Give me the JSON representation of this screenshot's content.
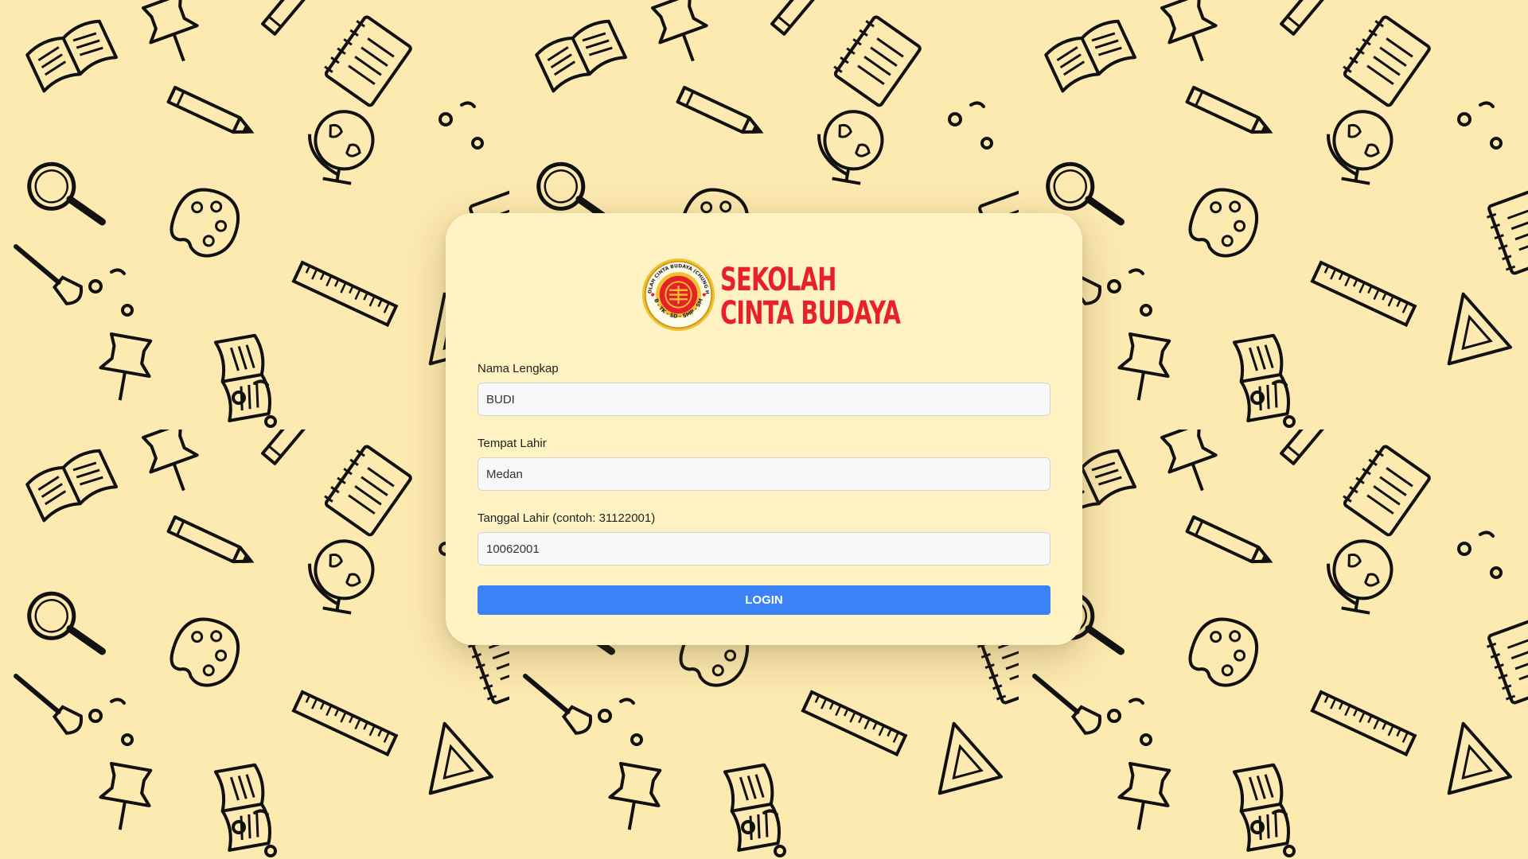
{
  "brand": {
    "line1": "SEKOLAH",
    "line2": "CINTA BUDAYA",
    "seal_ring_text": "SEKOLAH CINTA BUDAYA (CHUNG HUA)",
    "seal_grades_text": "KB - TK - SD - SMP - SMA",
    "brand_red": "#e8202a",
    "seal_gold": "#f2c230"
  },
  "form": {
    "name_label": "Nama Lengkap",
    "name_value": "BUDI",
    "birthplace_label": "Tempat Lahir",
    "birthplace_value": "Medan",
    "birthdate_label": "Tanggal Lahir (contoh: 31122001)",
    "birthdate_value": "10062001",
    "login_label": "LOGIN",
    "login_color": "#3b82f6"
  },
  "background": {
    "color": "#fdeab0",
    "pattern": "school doodle icons (books, pencils, globes, palettes, rulers, pushpins, notebooks)"
  }
}
